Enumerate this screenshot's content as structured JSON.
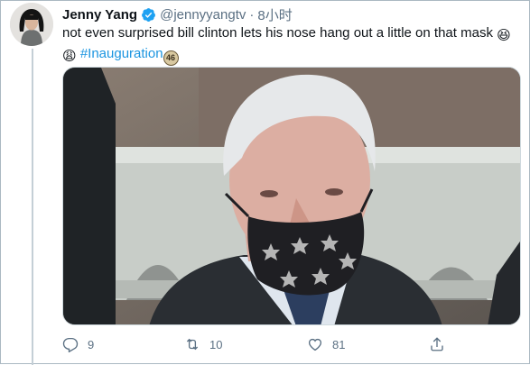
{
  "tweet": {
    "author_name": "Jenny Yang",
    "handle": "@jennyyangtv",
    "separator": "·",
    "time": "8小时",
    "text_main": "not even surprised bill clinton lets his nose hang out a little on that mask",
    "emoji_1": "😆",
    "emoji_2": "😩",
    "hashtag": "#Inauguration",
    "badge": "46",
    "verified_icon": "verified-badge-icon",
    "colors": {
      "accent": "#1b95e0",
      "secondary_text": "#5b7083",
      "border": "#aab8c2"
    }
  },
  "actions": {
    "reply_count": "9",
    "retweet_count": "10",
    "like_count": "81",
    "icons": [
      "reply-icon",
      "retweet-icon",
      "like-icon",
      "share-icon"
    ]
  }
}
